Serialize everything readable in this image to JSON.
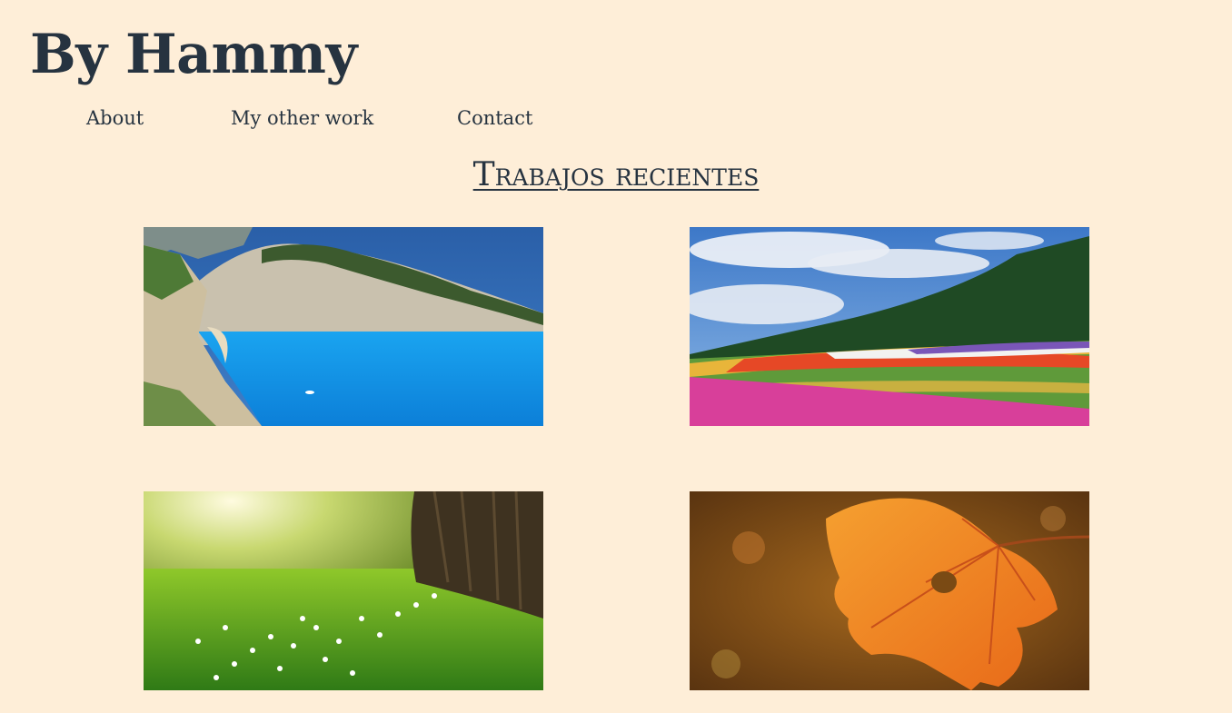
{
  "site": {
    "title": "By Hammy"
  },
  "nav": {
    "items": [
      {
        "label": "About"
      },
      {
        "label": "My other work"
      },
      {
        "label": "Contact"
      }
    ]
  },
  "section": {
    "title": "Trabajos recientes"
  },
  "gallery": {
    "images": [
      {
        "name": "cliff-beach-photo"
      },
      {
        "name": "flower-field-photo"
      },
      {
        "name": "meadow-tree-photo"
      },
      {
        "name": "autumn-leaf-photo"
      }
    ]
  },
  "colors": {
    "background": "#feeed8",
    "text": "#263340"
  }
}
